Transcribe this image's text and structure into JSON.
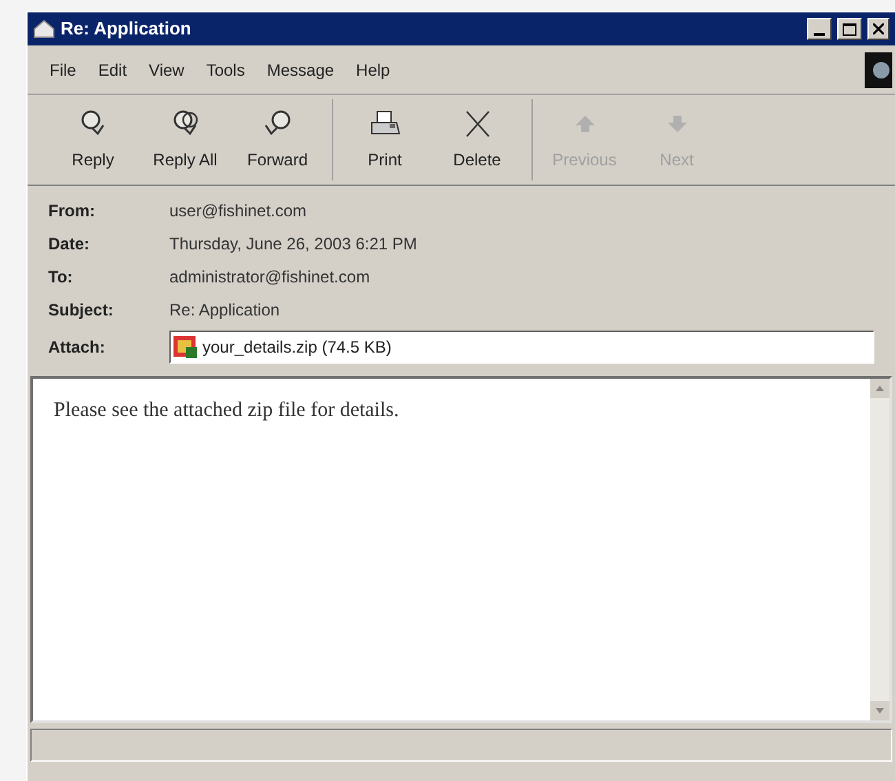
{
  "window": {
    "title": "Re: Application"
  },
  "menu": [
    "File",
    "Edit",
    "View",
    "Tools",
    "Message",
    "Help"
  ],
  "toolbar": [
    [
      {
        "label": "Reply",
        "kind": "reply",
        "disabled": false
      },
      {
        "label": "Reply All",
        "kind": "reply_all",
        "disabled": false
      },
      {
        "label": "Forward",
        "kind": "forward",
        "disabled": false
      }
    ],
    [
      {
        "label": "Print",
        "kind": "print",
        "disabled": false
      },
      {
        "label": "Delete",
        "kind": "delete",
        "disabled": false
      }
    ],
    [
      {
        "label": "Previous",
        "kind": "up",
        "disabled": true
      },
      {
        "label": "Next",
        "kind": "down",
        "disabled": true
      }
    ]
  ],
  "headers": [
    {
      "label": "From:",
      "value": "user@fishinet.com",
      "kind": "text"
    },
    {
      "label": "Date:",
      "value": "Thursday, June 26, 2003 6:21 PM",
      "kind": "text"
    },
    {
      "label": "To:",
      "value": "administrator@fishinet.com",
      "kind": "text"
    },
    {
      "label": "Subject:",
      "value": "Re: Application",
      "kind": "text"
    },
    {
      "label": "Attach:",
      "value": "your_details.zip (74.5 KB)",
      "kind": "attachment"
    }
  ],
  "body": "Please see the attached zip file for details."
}
